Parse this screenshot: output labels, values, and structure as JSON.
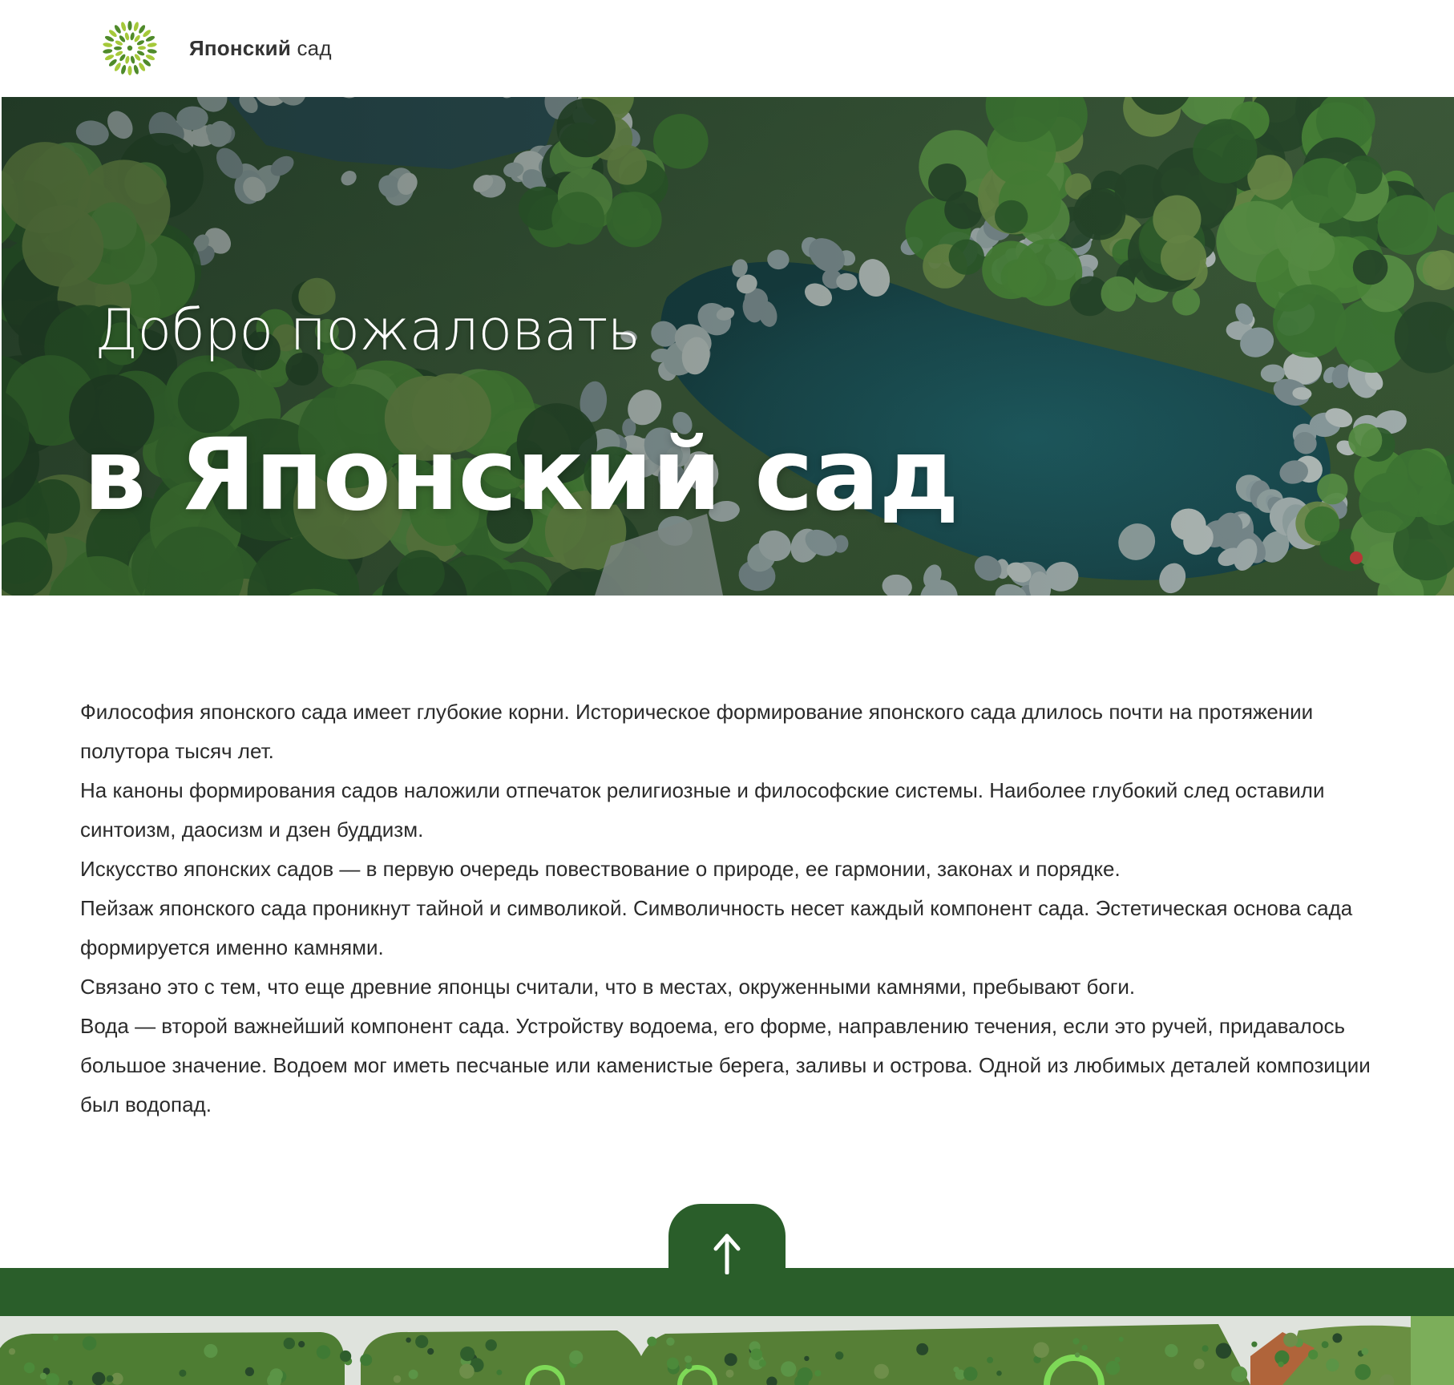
{
  "header": {
    "logo_icon": "green-leaf-burst-icon",
    "brand_bold": "Японский",
    "brand_light": " сад"
  },
  "hero": {
    "kicker": "Добро пожаловать",
    "title": "в Японский сад"
  },
  "article": {
    "paragraphs": [
      "Философия японского сада имеет глубокие корни. Историческое формирование японского сада длилось почти на протяжении полутора тысяч лет.",
      "На каноны формирования садов наложили отпечаток религиозные и философские системы. Наиболее глубокий след оставили синтоизм, даосизм и дзен буддизм.",
      "Искусство японских садов — в первую очередь повествование о природе, ее гармонии, законах и порядке.",
      "Пейзаж японского сада проникнут тайной и символикой. Символичность несет каждый компонент сада. Эстетическая основа сада формируется именно камнями.",
      "Связано это с тем, что еще древние японцы считали, что в местах, окруженными камнями, пребывают боги.",
      "Вода — второй важнейший компонент сада. Устройству водоема, его форме, направлению течения, если это ручей, придавалось большое значение. Водоем мог иметь песчаные или каменистые берега, заливы и острова. Одной из любимых деталей композиции был водопад."
    ]
  },
  "back_to_top": {
    "icon": "arrow-up-icon"
  },
  "colors": {
    "brand_green": "#2a5e2a",
    "logo_green_dark": "#4f8a2a",
    "logo_green_light": "#a5c93a",
    "text_dark": "#2b2b2b"
  }
}
